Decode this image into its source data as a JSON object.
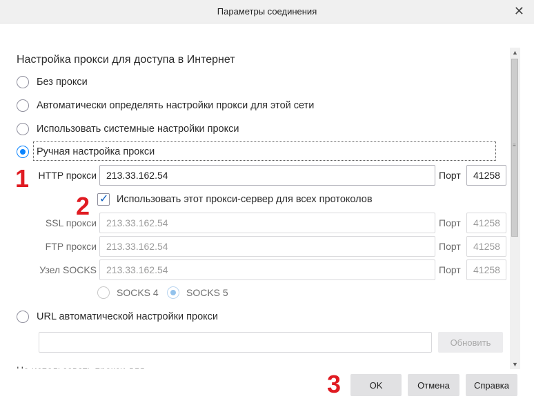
{
  "window": {
    "title": "Параметры соединения",
    "close_glyph": "✕"
  },
  "section_title": "Настройка прокси для доступа в Интернет",
  "proxy_modes": [
    {
      "label": "Без прокси",
      "checked": false
    },
    {
      "label": "Автоматически определять настройки прокси для этой сети",
      "checked": false
    },
    {
      "label": "Использовать системные настройки прокси",
      "checked": false
    },
    {
      "label": "Ручная настройка прокси",
      "checked": true
    }
  ],
  "manual": {
    "http": {
      "label": "HTTP прокси",
      "value": "213.33.162.54",
      "port_label": "Порт",
      "port": "41258"
    },
    "use_for_all": {
      "label": "Использовать этот прокси-сервер для всех протоколов",
      "checked": true
    },
    "ssl": {
      "label": "SSL прокси",
      "value": "213.33.162.54",
      "port_label": "Порт",
      "port": "41258"
    },
    "ftp": {
      "label": "FTP прокси",
      "value": "213.33.162.54",
      "port_label": "Порт",
      "port": "41258"
    },
    "socks": {
      "label": "Узел SOCKS",
      "value": "213.33.162.54",
      "port_label": "Порт",
      "port": "41258"
    },
    "socks_versions": [
      {
        "label": "SOCKS 4",
        "checked": false
      },
      {
        "label": "SOCKS 5",
        "checked": true
      }
    ]
  },
  "pac": {
    "label": "URL автоматической настройки прокси",
    "value": "",
    "reload_label": "Обновить"
  },
  "cut_off_text": "Не использовать прокси для",
  "buttons": {
    "ok": "OK",
    "cancel": "Отмена",
    "help": "Справка"
  },
  "annotations": [
    "1",
    "2",
    "3"
  ],
  "colors": {
    "accent": "#0a84ff",
    "annotation": "#e01b22"
  }
}
